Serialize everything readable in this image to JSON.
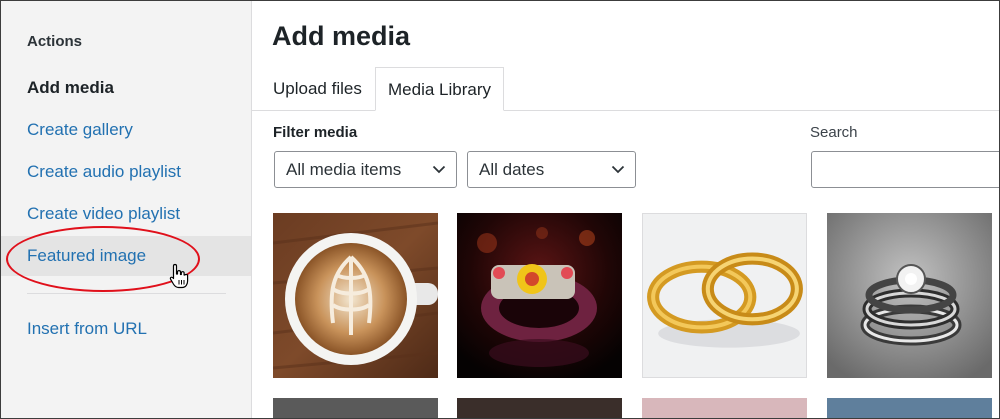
{
  "sidebar": {
    "heading": "Actions",
    "items": [
      {
        "label": "Add media"
      },
      {
        "label": "Create gallery"
      },
      {
        "label": "Create audio playlist"
      },
      {
        "label": "Create video playlist"
      },
      {
        "label": "Featured image"
      },
      {
        "label": "Insert from URL"
      }
    ]
  },
  "main": {
    "title": "Add media",
    "tabs": [
      {
        "label": "Upload files"
      },
      {
        "label": "Media Library"
      }
    ],
    "filter": {
      "label": "Filter media",
      "type_value": "All media items",
      "date_value": "All dates"
    },
    "search": {
      "label": "Search",
      "value": ""
    }
  },
  "colors": {
    "link": "#2271b1",
    "highlight_oval": "#e0101b",
    "sidebar_bg": "#f3f3f3"
  }
}
